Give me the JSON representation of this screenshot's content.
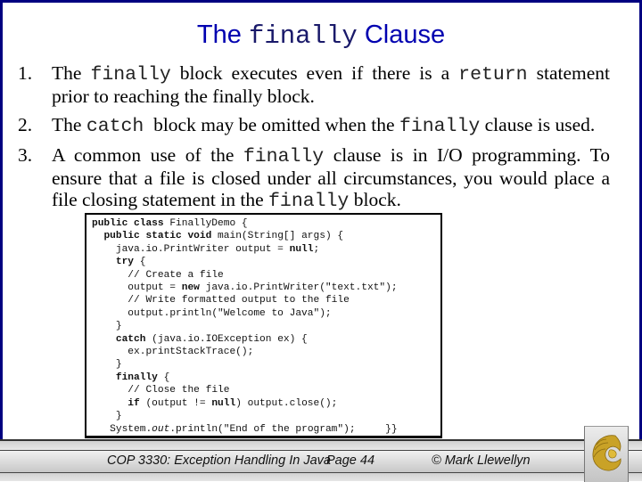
{
  "slide": {
    "title": {
      "prefix": "The ",
      "code": "finally",
      "suffix": " Clause"
    },
    "bullets": [
      {
        "number": "1.",
        "parts": [
          "The ",
          "finally",
          " block executes even if there is a ",
          "return",
          " statement prior to reaching the finally block."
        ]
      },
      {
        "number": "2.",
        "parts": [
          "The ",
          "catch",
          "  block may be omitted when the ",
          "finally",
          " clause is used."
        ]
      },
      {
        "number": "3.",
        "parts": [
          "A common use of the ",
          "finally",
          " clause is in I/O programming.  To ensure that a file is closed under all circumstances, you would place a file closing statement in the ",
          "finally",
          " block."
        ]
      }
    ],
    "code": {
      "lines": [
        "public class FinallyDemo {",
        "  public static void main(String[] args) {",
        "    java.io.PrintWriter output = null;",
        "    try {",
        "      // Create a file",
        "      output = new java.io.PrintWriter(\"text.txt\");",
        "      // Write formatted output to the file",
        "      output.println(\"Welcome to Java\");",
        "    }",
        "    catch (java.io.IOException ex) {",
        "      ex.printStackTrace();",
        "    }",
        "    finally {",
        "      // Close the file",
        "      if (output != null) output.close();",
        "    }",
        "   System.out.println(\"End of the program\");     }}"
      ],
      "keywords": [
        "public",
        "class",
        "static",
        "void",
        "null",
        "try",
        "new",
        "catch",
        "finally",
        "if"
      ]
    },
    "footer": {
      "course": "COP 3330:  Exception Handling In Java",
      "page": "Page 44",
      "author": "© Mark Llewellyn"
    },
    "colors": {
      "title": "#0000b0",
      "frame": "#000080",
      "logo_gold": "#c9a227"
    }
  }
}
